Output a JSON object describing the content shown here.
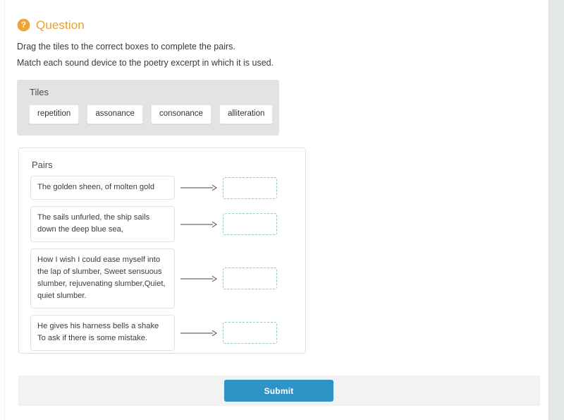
{
  "question": {
    "icon": "question-mark-circle-icon",
    "title": "Question",
    "instruction_line_1": "Drag the tiles to the correct boxes to complete the pairs.",
    "instruction_line_2": "Match each sound device to the poetry excerpt in which it is used."
  },
  "tiles_panel": {
    "heading": "Tiles",
    "tiles": [
      {
        "label": "repetition"
      },
      {
        "label": "assonance"
      },
      {
        "label": "consonance"
      },
      {
        "label": "alliteration"
      }
    ]
  },
  "pairs_panel": {
    "heading": "Pairs",
    "arrow_icon": "arrow-right-icon",
    "pairs": [
      {
        "excerpt": "The golden sheen, of molten gold",
        "drop_value": ""
      },
      {
        "excerpt": "The sails unfurled, the ship sails down the deep blue sea,",
        "drop_value": ""
      },
      {
        "excerpt": "How I wish I could ease myself into the lap of slumber, Sweet sensuous slumber, rejuvenating slumber,Quiet, quiet slumber.",
        "drop_value": ""
      },
      {
        "excerpt": "He gives his harness bells a shake To ask if there is some mistake.",
        "drop_value": ""
      }
    ]
  },
  "footer": {
    "submit_label": "Submit"
  },
  "colors": {
    "accent_orange": "#e3a13a",
    "submit_blue": "#3093c7",
    "tiles_panel_gray": "#e3e3e3",
    "footer_gray": "#f2f2f2",
    "drop_zone_border": "#9ec3c6"
  }
}
